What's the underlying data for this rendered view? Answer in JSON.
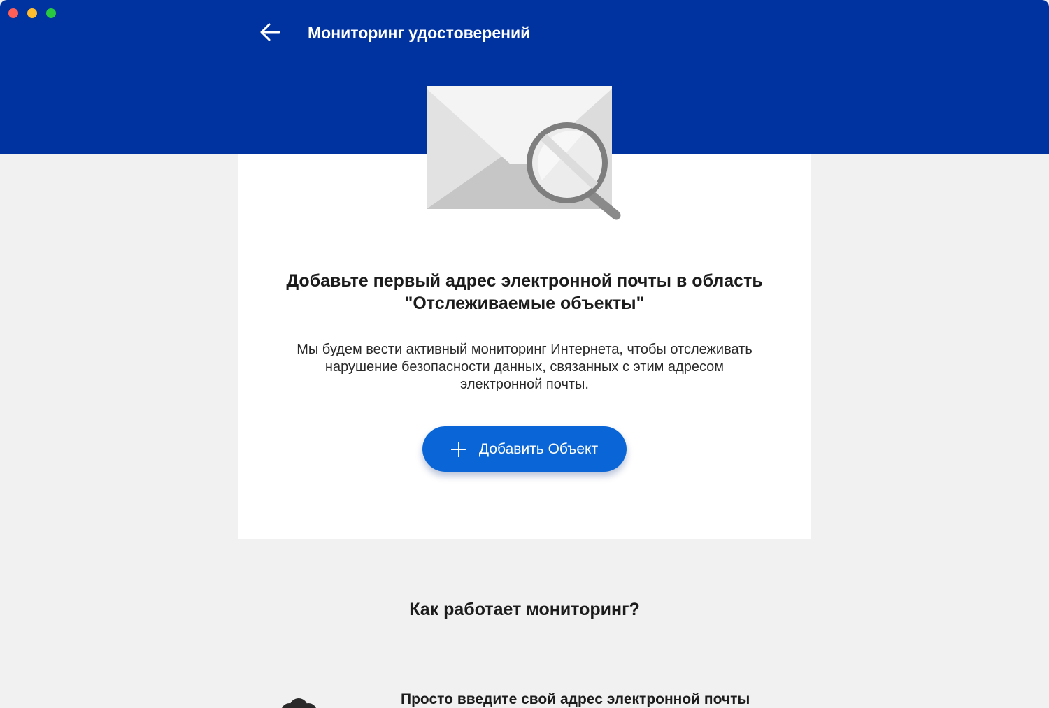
{
  "window": {
    "controls": [
      "close",
      "minimize",
      "maximize"
    ]
  },
  "header": {
    "back_icon": "arrow-left-icon",
    "title": "Мониторинг удостоверений",
    "background": "#0033a0"
  },
  "illustration": {
    "icon": "envelope-magnifier-icon"
  },
  "card": {
    "title_line1": "Добавьте первый адрес электронной почты в область",
    "title_line2": "\"Отслеживаемые объекты\"",
    "desc_line1": "Мы будем вести активный мониторинг Интернета, чтобы отслеживать",
    "desc_line2": "нарушение безопасности данных, связанных с этим адресом",
    "desc_line3": "электронной почты.",
    "add_button_label": "Добавить Объект",
    "add_button_icon": "plus-icon",
    "accent": "#0a66d6"
  },
  "how_it_works": {
    "title": "Как работает мониторинг?",
    "step1_icon": "cloud-icon",
    "step1_text": "Просто введите свой адрес электронной почты"
  }
}
